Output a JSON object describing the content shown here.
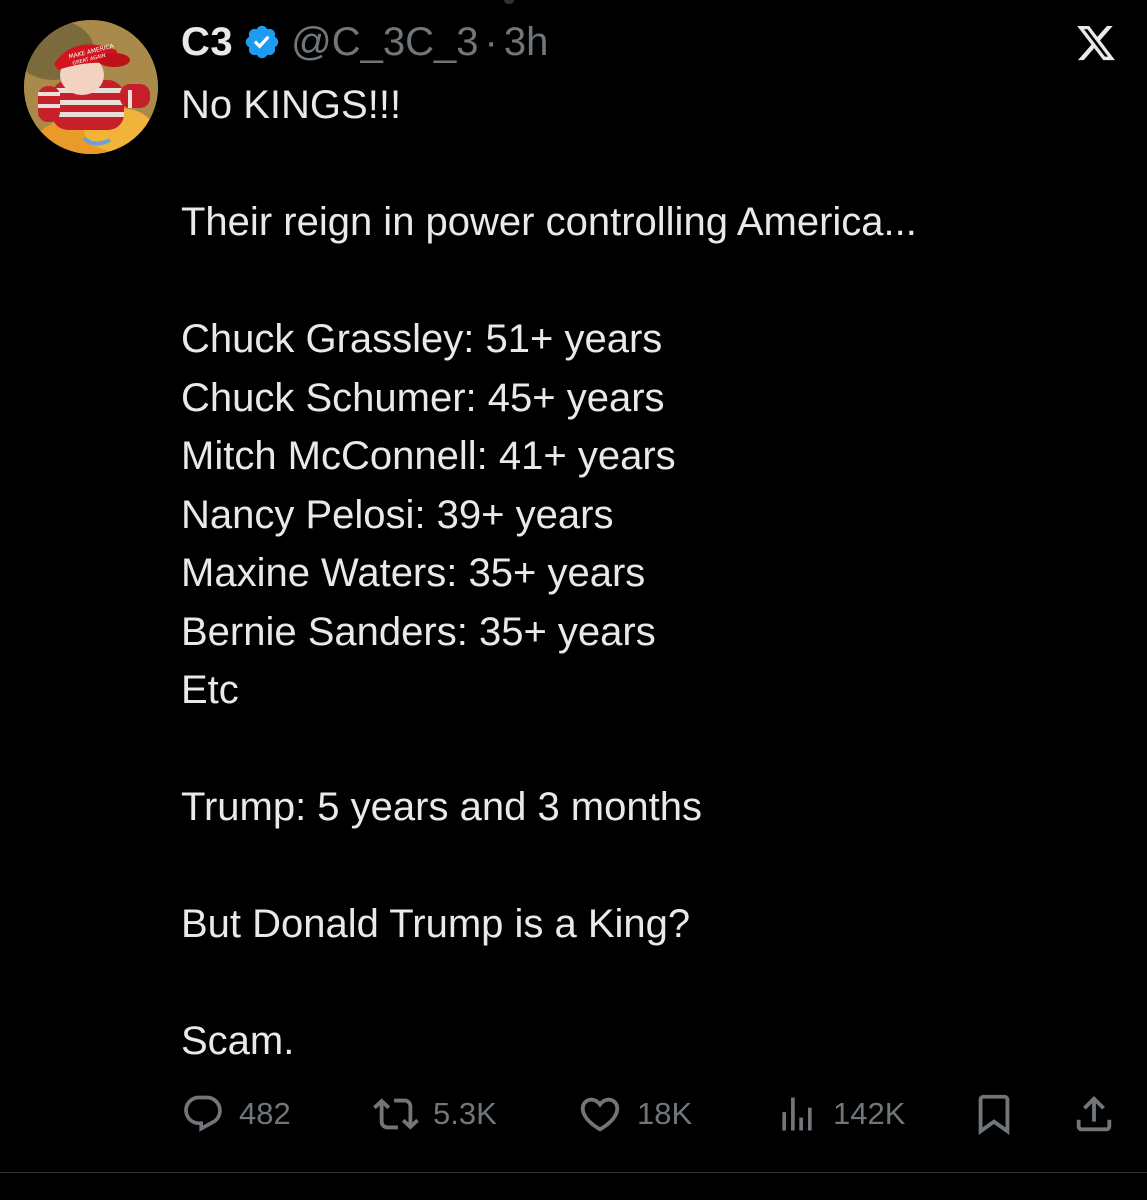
{
  "author": {
    "display_name": "C3",
    "handle": "@C_3C_3",
    "separator": "·",
    "time": "3h",
    "verified": true,
    "avatar_icon": "child-in-red-cap-avatar"
  },
  "platform_logo": "x-logo",
  "tweet": {
    "line_1": "No KINGS!!!",
    "line_2": "Their reign in power controlling America...",
    "tenures": [
      "Chuck Grassley: 51+ years",
      "Chuck Schumer: 45+ years",
      "Mitch McConnell: 41+ years",
      "Nancy Pelosi: 39+ years",
      "Maxine Waters: 35+ years",
      "Bernie Sanders: 35+ years",
      "Etc"
    ],
    "line_trump": "Trump: 5 years and 3 months",
    "line_question": "But Donald Trump is a King?",
    "line_end": "Scam."
  },
  "actions": {
    "replies": "482",
    "reposts": "5.3K",
    "likes": "18K",
    "views": "142K"
  },
  "colors": {
    "background": "#000000",
    "text": "#e7e9ea",
    "secondary": "#71767b",
    "verified_blue": "#1d9bf0"
  }
}
